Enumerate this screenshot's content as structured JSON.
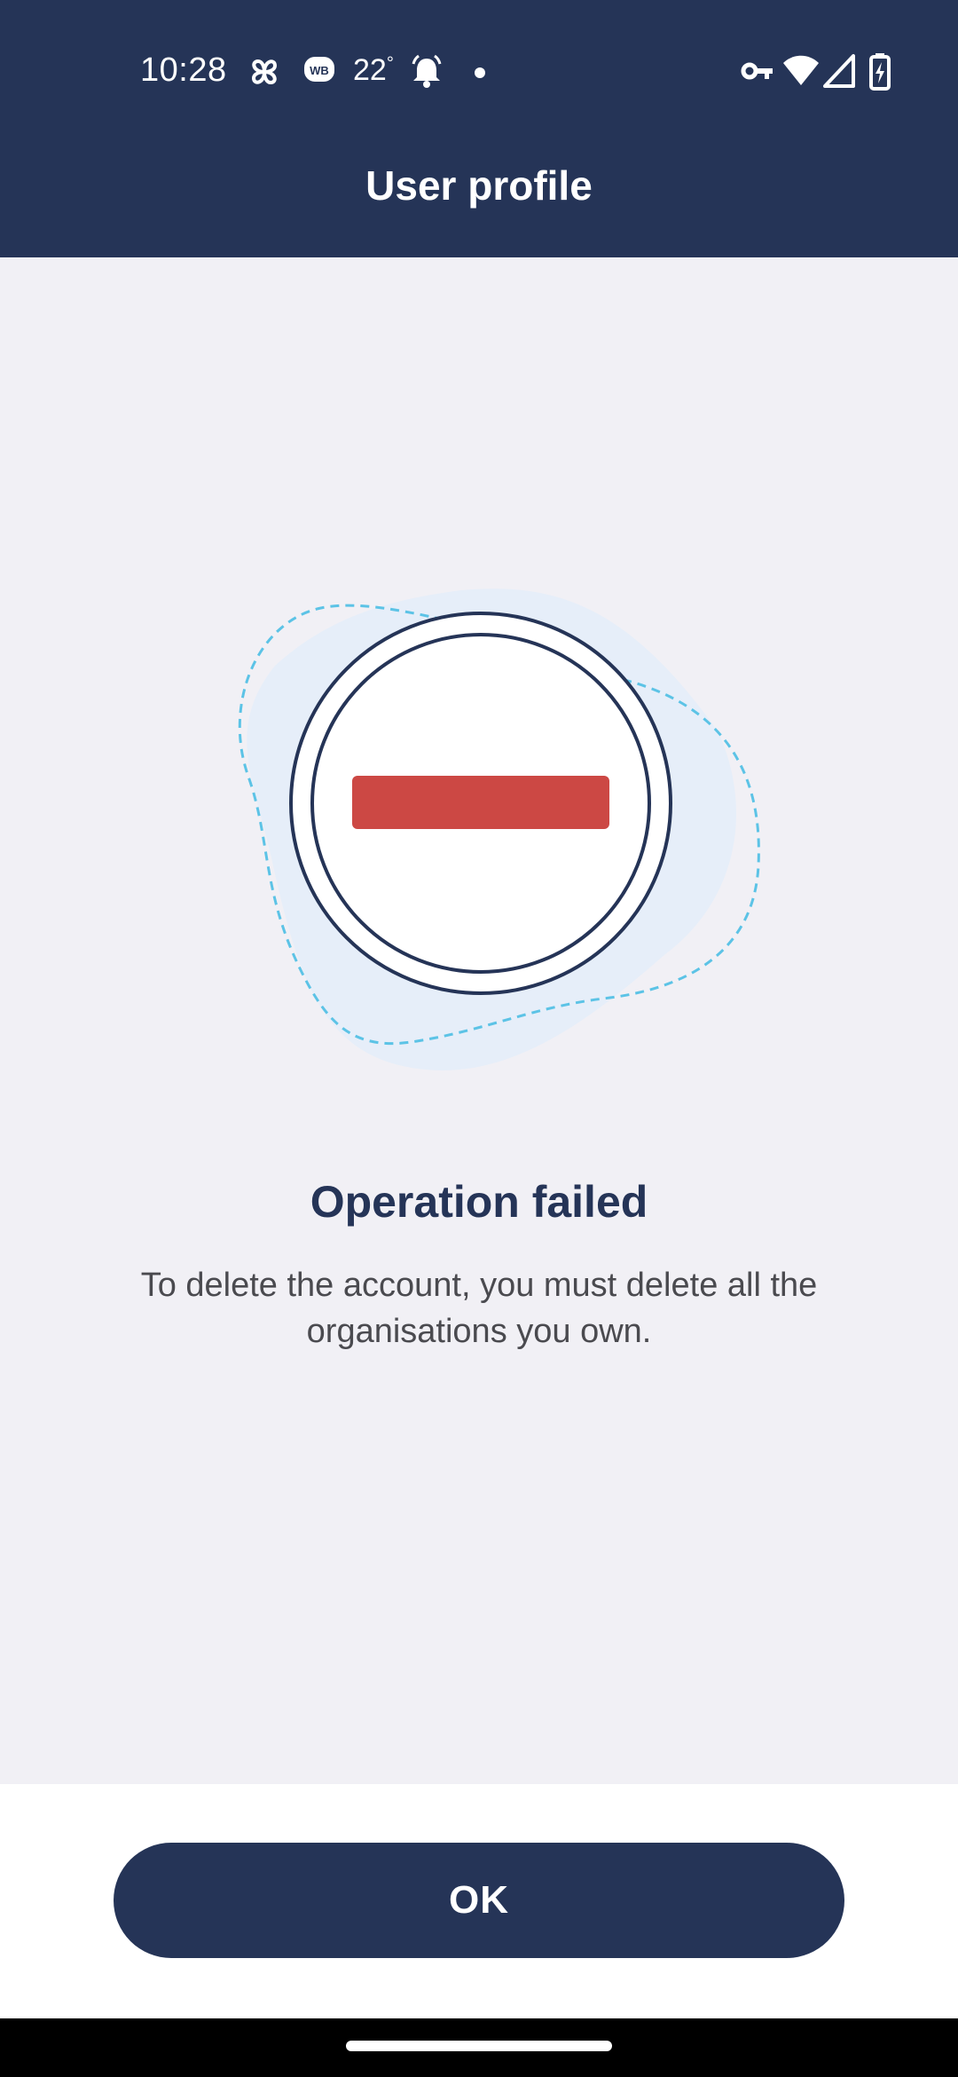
{
  "status_bar": {
    "time": "10:28",
    "weather_temp": "22",
    "weather_degree": "°",
    "icons": [
      "pinwheel-icon",
      "wb-badge-icon",
      "bell-alarm-icon",
      "dot-icon",
      "vpn-key-icon",
      "wifi-icon",
      "signal-icon",
      "battery-charging-icon"
    ]
  },
  "header": {
    "title": "User profile"
  },
  "result": {
    "heading": "Operation failed",
    "message": "To delete the account, you must delete all the organisations you own.",
    "icon": "error-minus-icon"
  },
  "footer": {
    "ok_label": "OK"
  },
  "colors": {
    "primary": "#253457",
    "background": "#f1f0f5",
    "error": "#cc4844",
    "dashed_outline": "#5cc3e6",
    "blob": "#e6eef9"
  }
}
